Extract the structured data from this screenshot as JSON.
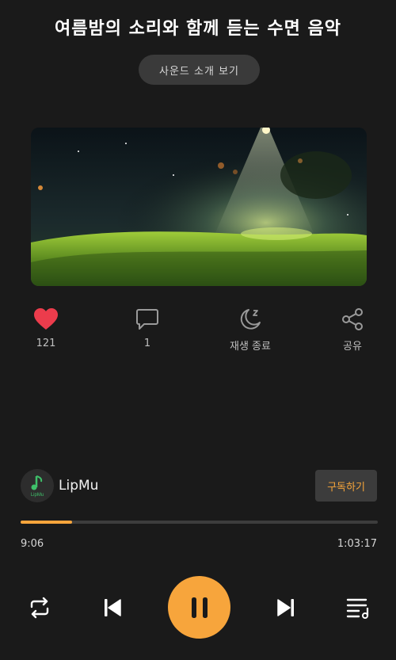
{
  "header": {
    "title": "여름밤의 소리와 함께 듣는 수면 음악",
    "intro_button": "사운드 소개 보기"
  },
  "actions": [
    {
      "icon": "heart-icon",
      "label": "121"
    },
    {
      "icon": "comment-icon",
      "label": "1"
    },
    {
      "icon": "moon-sleep-icon",
      "label": "재생 종료"
    },
    {
      "icon": "share-icon",
      "label": "공유"
    }
  ],
  "channel": {
    "logo_text": "LipMu",
    "name": "LipMu",
    "subscribe_label": "구독하기"
  },
  "player": {
    "elapsed": "9:06",
    "duration": "1:03:17",
    "progress": 0.144,
    "accent_color": "#f7a53c"
  }
}
